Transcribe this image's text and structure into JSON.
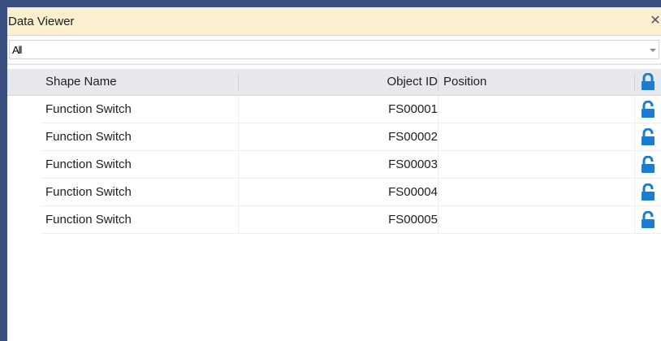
{
  "window": {
    "title": "Data Viewer",
    "close_symbol": "✕"
  },
  "filter": {
    "selected": "All"
  },
  "table": {
    "columns": {
      "shape_name": "Shape Name",
      "object_id": "Object ID",
      "position": "Position",
      "lock": "lock-icon"
    },
    "rows": [
      {
        "shape_name": "Function Switch",
        "object_id": "FS00001",
        "position": "",
        "locked": false
      },
      {
        "shape_name": "Function Switch",
        "object_id": "FS00002",
        "position": "",
        "locked": false
      },
      {
        "shape_name": "Function Switch",
        "object_id": "FS00003",
        "position": "",
        "locked": false
      },
      {
        "shape_name": "Function Switch",
        "object_id": "FS00004",
        "position": "",
        "locked": false
      },
      {
        "shape_name": "Function Switch",
        "object_id": "FS00005",
        "position": "",
        "locked": false
      }
    ]
  },
  "colors": {
    "frame": "#3b4f81",
    "titlebar": "#fbefcf",
    "header": "#e6e8ec",
    "lock_icon": "#1e7bd0"
  }
}
